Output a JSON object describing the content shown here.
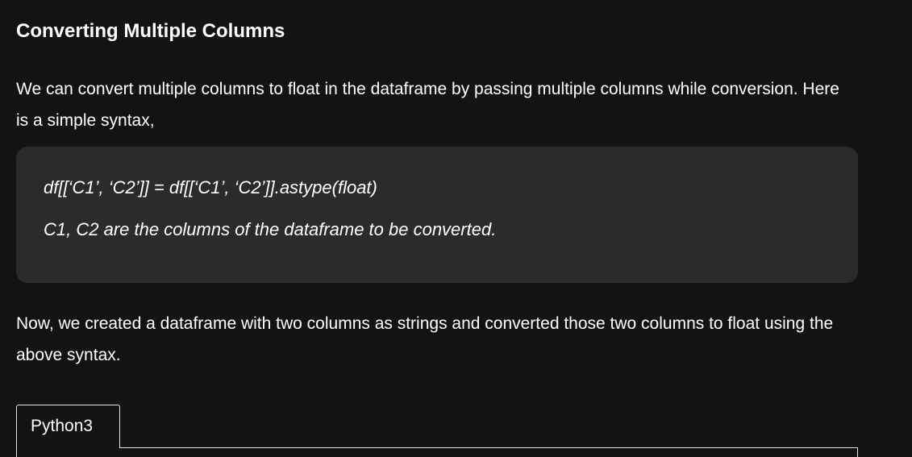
{
  "article": {
    "heading": "Converting Multiple Columns",
    "intro": "We can convert multiple columns to float in the dataframe by passing multiple columns while conversion. Here is a simple syntax,",
    "syntax": {
      "code_line": "df[[‘C1’, ‘C2’]] = df[[‘C1’, ‘C2’]].astype(float)",
      "description": "C1, C2 are the columns of the dataframe to be converted."
    },
    "example_intro": "Now, we created a dataframe with two columns as strings and converted those two columns to float using the above syntax."
  },
  "code_tabs": {
    "active_tab_label": "Python3"
  },
  "colors": {
    "background": "#131313",
    "syntax_box": "#2b2b2b",
    "text": "#ffffff",
    "border": "#e6e6e6"
  }
}
